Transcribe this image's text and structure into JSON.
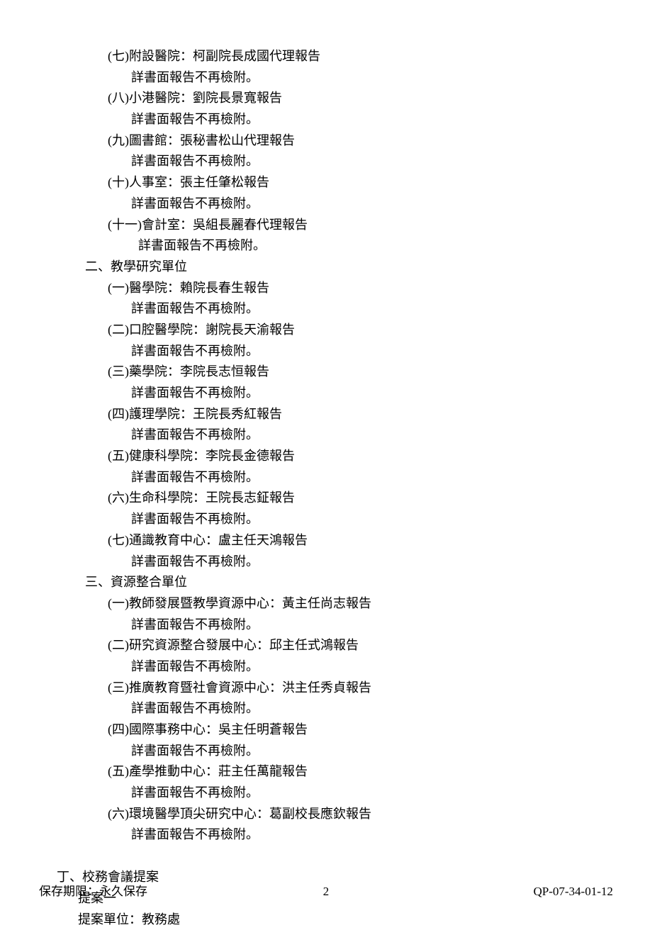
{
  "section1": {
    "items": [
      {
        "title": "(七)附設醫院：柯副院長成國代理報告",
        "detail": "詳書面報告不再檢附。",
        "indent": "a"
      },
      {
        "title": "(八)小港醫院：劉院長景寬報告",
        "detail": "詳書面報告不再檢附。",
        "indent": "a"
      },
      {
        "title": "(九)圖書館：張秘書松山代理報告",
        "detail": "詳書面報告不再檢附。",
        "indent": "a"
      },
      {
        "title": "(十)人事室：張主任肇松報告",
        "detail": "詳書面報告不再檢附。",
        "indent": "a"
      },
      {
        "title": "(十一)會計室：吳組長麗春代理報告",
        "detail": "詳書面報告不再檢附。",
        "indent": "b"
      }
    ]
  },
  "section2": {
    "heading": "二、教學研究單位",
    "items": [
      {
        "title": "(一)醫學院：賴院長春生報告",
        "detail": "詳書面報告不再檢附。"
      },
      {
        "title": "(二)口腔醫學院：謝院長天渝報告",
        "detail": "詳書面報告不再檢附。"
      },
      {
        "title": "(三)藥學院：李院長志恒報告",
        "detail": "詳書面報告不再檢附。"
      },
      {
        "title": "(四)護理學院：王院長秀紅報告",
        "detail": "詳書面報告不再檢附。"
      },
      {
        "title": "(五)健康科學院：李院長金德報告",
        "detail": "詳書面報告不再檢附。"
      },
      {
        "title": "(六)生命科學院：王院長志鉦報告",
        "detail": "詳書面報告不再檢附。"
      },
      {
        "title": "(七)通識教育中心：盧主任天鴻報告",
        "detail": "詳書面報告不再檢附。"
      }
    ]
  },
  "section3": {
    "heading": "三、資源整合單位",
    "items": [
      {
        "title": "(一)教師發展暨教學資源中心：黃主任尚志報告",
        "detail": "詳書面報告不再檢附。"
      },
      {
        "title": "(二)研究資源整合發展中心：邱主任式鴻報告",
        "detail": "詳書面報告不再檢附。"
      },
      {
        "title": "(三)推廣教育暨社會資源中心：洪主任秀貞報告",
        "detail": "詳書面報告不再檢附。"
      },
      {
        "title": "(四)國際事務中心：吳主任明蒼報告",
        "detail": "詳書面報告不再檢附。"
      },
      {
        "title": "(五)產學推動中心：莊主任萬龍報告",
        "detail": "詳書面報告不再檢附。"
      },
      {
        "title": "(六)環境醫學頂尖研究中心：葛副校長應欽報告",
        "detail": "詳書面報告不再檢附。"
      }
    ]
  },
  "section4": {
    "heading": "丁、校務會議提案",
    "proposal_num": "提案一",
    "proposal_unit": "提案單位：教務處"
  },
  "footer": {
    "left": "保存期限：永久保存",
    "center": "2",
    "right": "QP-07-34-01-12"
  }
}
